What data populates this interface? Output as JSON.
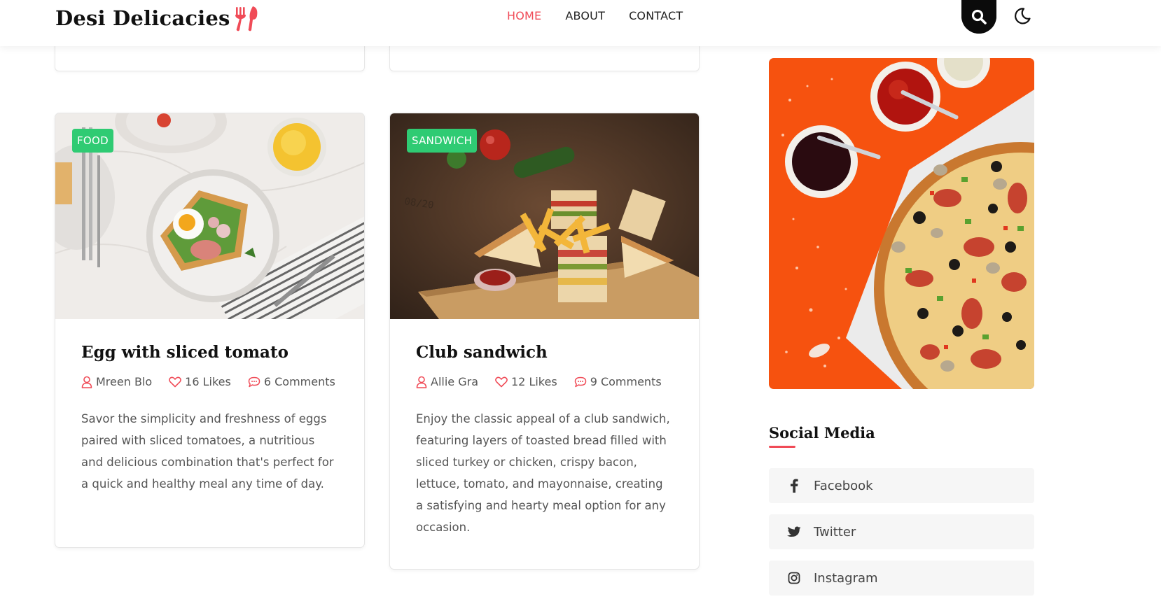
{
  "brand": {
    "name": "Desi Delicacies",
    "icon": "fork-knife-icon",
    "accent": "#f04b57"
  },
  "nav": {
    "items": [
      {
        "label": "HOME",
        "active": true
      },
      {
        "label": "ABOUT",
        "active": false
      },
      {
        "label": "CONTACT",
        "active": false
      }
    ]
  },
  "header_icons": {
    "search": "search-icon",
    "theme": "moon-icon"
  },
  "posts": [
    {
      "category": "FOOD",
      "title": "Egg with sliced tomato",
      "author": "Mreen Blo",
      "likes": "16 Likes",
      "comments": "6 Comments",
      "excerpt": "Savor the simplicity and freshness of eggs paired with sliced tomatoes, a nutritious and delicious combination that's perfect for a quick and healthy meal any time of day."
    },
    {
      "category": "SANDWICH",
      "title": "Club sandwich",
      "author": "Allie Gra",
      "likes": "12 Likes",
      "comments": "9 Comments",
      "excerpt": "Enjoy the classic appeal of a club sandwich, featuring layers of toasted bread filled with sliced turkey or chicken, crispy bacon, lettuce, tomato, and mayonnaise, creating a satisfying and hearty meal option for any occasion."
    }
  ],
  "sidebar": {
    "social_title": "Social Media",
    "social": [
      {
        "label": "Facebook",
        "icon": "facebook-icon"
      },
      {
        "label": "Twitter",
        "icon": "twitter-icon"
      },
      {
        "label": "Instagram",
        "icon": "instagram-icon"
      }
    ]
  },
  "colors": {
    "badge": "#2fcb73",
    "pizza_bg": "#f6520f",
    "search_bg": "#0b0b0b"
  }
}
